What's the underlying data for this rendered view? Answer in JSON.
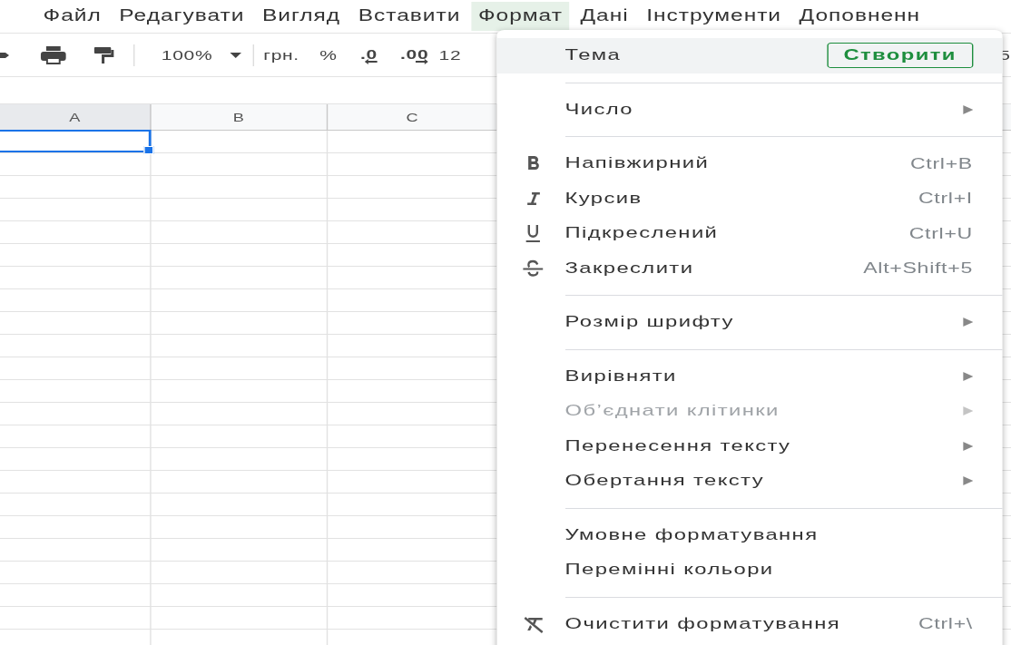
{
  "menubar": [
    {
      "label": "Файл",
      "selected": false
    },
    {
      "label": "Редагувати",
      "selected": false
    },
    {
      "label": "Вигляд",
      "selected": false
    },
    {
      "label": "Вставити",
      "selected": false
    },
    {
      "label": "Формат",
      "selected": true
    },
    {
      "label": "Дані",
      "selected": false
    },
    {
      "label": "Інструменти",
      "selected": false
    },
    {
      "label": "Доповненн",
      "selected": false
    }
  ],
  "toolbar": {
    "zoom": "100%",
    "currency": "грн.",
    "percent": "%",
    "decrease_decimal": ".0",
    "increase_decimal": ".00",
    "more_formats": "12",
    "trailing": "5"
  },
  "columns": [
    {
      "label": "A",
      "selected": true
    },
    {
      "label": "B",
      "selected": false
    },
    {
      "label": "C",
      "selected": false
    }
  ],
  "format_menu": {
    "sections": [
      [
        {
          "kind": "theme",
          "label": "Тема",
          "action": "Створити",
          "selected": true,
          "disabled": false
        }
      ],
      [
        {
          "kind": "submenu",
          "label": "Число",
          "selected": false,
          "disabled": false
        }
      ],
      [
        {
          "kind": "shortcut",
          "label": "Напівжирний",
          "shortcut": "Ctrl+B",
          "selected": false,
          "disabled": false
        },
        {
          "kind": "shortcut",
          "label": "Курсив",
          "shortcut": "Ctrl+I",
          "selected": false,
          "disabled": false
        },
        {
          "kind": "shortcut",
          "label": "Підкреслений",
          "shortcut": "Ctrl+U",
          "selected": false,
          "disabled": false
        },
        {
          "kind": "shortcut",
          "label": "Закреслити",
          "shortcut": "Alt+Shift+5",
          "selected": false,
          "disabled": false
        }
      ],
      [
        {
          "kind": "submenu",
          "label": "Розмір шрифту",
          "selected": false,
          "disabled": false
        }
      ],
      [
        {
          "kind": "submenu",
          "label": "Вирівняти",
          "selected": false,
          "disabled": false
        },
        {
          "kind": "submenu",
          "label": "Об’єднати клітинки",
          "selected": false,
          "disabled": true
        },
        {
          "kind": "submenu",
          "label": "Перенесення тексту",
          "selected": false,
          "disabled": false
        },
        {
          "kind": "submenu",
          "label": "Обертання тексту",
          "selected": false,
          "disabled": false
        }
      ],
      [
        {
          "kind": "plain",
          "label": "Умовне форматування",
          "selected": false,
          "disabled": false
        },
        {
          "kind": "plain",
          "label": "Перемінні кольори",
          "selected": false,
          "disabled": false
        }
      ],
      [
        {
          "kind": "shortcut",
          "label": "Очистити форматування",
          "shortcut": "Ctrl+\\",
          "selected": false,
          "disabled": false
        }
      ]
    ]
  }
}
